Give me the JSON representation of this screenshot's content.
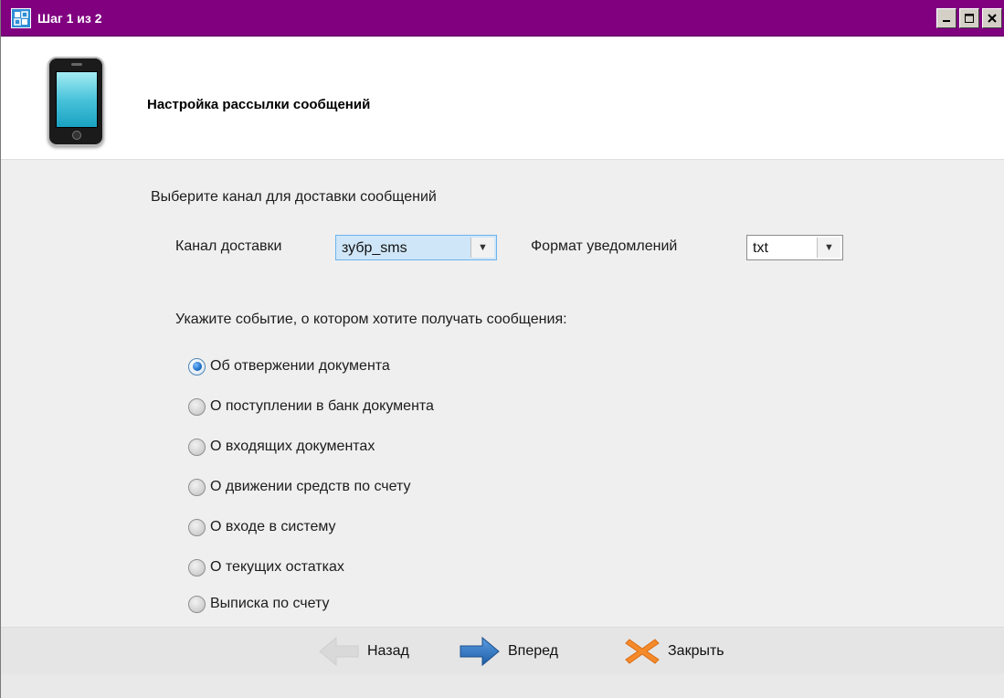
{
  "window": {
    "title": "Шаг 1 из 2",
    "app_icon": "wizard-app-icon",
    "controls": [
      "minimize-icon",
      "maximize-icon",
      "close-icon"
    ]
  },
  "header": {
    "icon": "mobile-phone-icon",
    "title": "Настройка рассылки сообщений"
  },
  "channel_section": {
    "heading": "Выберите канал для доставки сообщений",
    "delivery_channel_label": "Канал доставки",
    "delivery_channel_value": "зубр_sms",
    "format_label": "Формат уведомлений",
    "format_value": "txt"
  },
  "events_section": {
    "heading": "Укажите событие, о котором хотите получать сообщения:",
    "options": [
      {
        "label": "Об отвержении документа",
        "checked": true
      },
      {
        "label": "О поступлении в банк документа",
        "checked": false
      },
      {
        "label": "О входящих документах",
        "checked": false
      },
      {
        "label": "О движении средств по счету",
        "checked": false
      },
      {
        "label": "О входе в систему",
        "checked": false
      },
      {
        "label": "О текущих остатках",
        "checked": false
      },
      {
        "label": "Выписка по счету",
        "checked": false
      }
    ]
  },
  "footer": {
    "back_label": "Назад",
    "back_enabled": false,
    "forward_label": "Вперед",
    "close_label": "Закрыть"
  },
  "colors": {
    "titlebar": "#800080",
    "body": "#efefef",
    "forward_arrow": "#2f74c0",
    "close_x": "#f58a2a"
  }
}
